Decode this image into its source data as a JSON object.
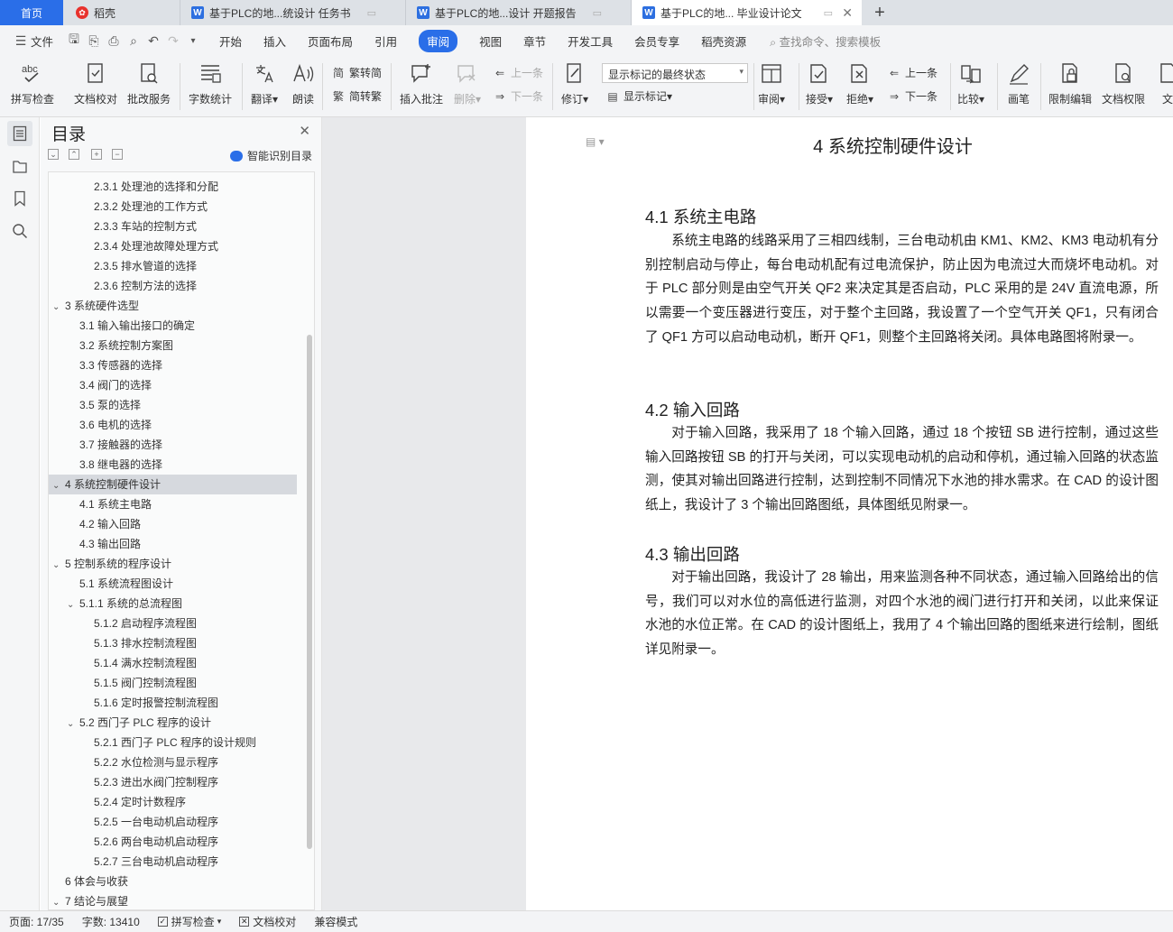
{
  "tabs": {
    "home": "首页",
    "daoke": "稻壳",
    "doc1": "基于PLC的地...统设计 任务书",
    "doc2": "基于PLC的地...设计 开题报告",
    "doc3": "基于PLC的地... 毕业设计论文"
  },
  "menu": {
    "file": "文件",
    "items": [
      "开始",
      "插入",
      "页面布局",
      "引用",
      "审阅",
      "视图",
      "章节",
      "开发工具",
      "会员专享",
      "稻壳资源"
    ],
    "active": "审阅",
    "search": "查找命令、搜索模板"
  },
  "ribbon": {
    "spellcheck": "拼写检查",
    "proofread": "文档校对",
    "batch": "批改服务",
    "wordcount": "字数统计",
    "translate": "翻译",
    "read": "朗读",
    "trad": "繁转简",
    "simp": "简转繁",
    "insert_comment": "插入批注",
    "delete": "删除",
    "prev_comment": "上一条",
    "next_comment": "下一条",
    "revise": "修订",
    "markup_state": "显示标记的最终状态",
    "show_markup": "显示标记",
    "review": "审阅",
    "accept": "接受",
    "reject": "拒绝",
    "prev_change": "上一条",
    "next_change": "下一条",
    "compare": "比较",
    "pen": "画笔",
    "restrict": "限制编辑",
    "permission": "文档权限",
    "cut_label": "文"
  },
  "nav": {
    "title": "目录",
    "smart": "智能识别目录",
    "items": [
      {
        "text": "2.3.1  处理池的选择和分配",
        "level": 3,
        "arrow": ""
      },
      {
        "text": "2.3.2  处理池的工作方式",
        "level": 3,
        "arrow": ""
      },
      {
        "text": "2.3.3  车站的控制方式",
        "level": 3,
        "arrow": ""
      },
      {
        "text": "2.3.4  处理池故障处理方式",
        "level": 3,
        "arrow": ""
      },
      {
        "text": "2.3.5  排水管道的选择",
        "level": 3,
        "arrow": ""
      },
      {
        "text": "2.3.6  控制方法的选择",
        "level": 3,
        "arrow": ""
      },
      {
        "text": "3  系统硬件选型",
        "level": 1,
        "arrow": "v"
      },
      {
        "text": "3.1  输入输出接口的确定",
        "level": 2,
        "arrow": ""
      },
      {
        "text": "3.2  系统控制方案图",
        "level": 2,
        "arrow": ""
      },
      {
        "text": "3.3  传感器的选择",
        "level": 2,
        "arrow": ""
      },
      {
        "text": "3.4  阀门的选择",
        "level": 2,
        "arrow": ""
      },
      {
        "text": "3.5  泵的选择",
        "level": 2,
        "arrow": ""
      },
      {
        "text": "3.6  电机的选择",
        "level": 2,
        "arrow": ""
      },
      {
        "text": "3.7  接触器的选择",
        "level": 2,
        "arrow": ""
      },
      {
        "text": "3.8  继电器的选择",
        "level": 2,
        "arrow": ""
      },
      {
        "text": "4  系统控制硬件设计",
        "level": 1,
        "arrow": "v",
        "selected": true
      },
      {
        "text": "4.1  系统主电路",
        "level": 2,
        "arrow": ""
      },
      {
        "text": "4.2  输入回路",
        "level": 2,
        "arrow": ""
      },
      {
        "text": "4.3  输出回路",
        "level": 2,
        "arrow": ""
      },
      {
        "text": "5  控制系统的程序设计",
        "level": 1,
        "arrow": "v"
      },
      {
        "text": "5.1  系统流程图设计",
        "level": 2,
        "arrow": ""
      },
      {
        "text": "5.1.1 系统的总流程图",
        "level": 2,
        "arrow": "v"
      },
      {
        "text": "5.1.2  启动程序流程图",
        "level": 3,
        "arrow": ""
      },
      {
        "text": "5.1.3  排水控制流程图",
        "level": 3,
        "arrow": ""
      },
      {
        "text": "5.1.4  满水控制流程图",
        "level": 3,
        "arrow": ""
      },
      {
        "text": "5.1.5  阀门控制流程图",
        "level": 3,
        "arrow": ""
      },
      {
        "text": "5.1.6  定时报警控制流程图",
        "level": 3,
        "arrow": ""
      },
      {
        "text": "5.2  西门子 PLC 程序的设计",
        "level": 2,
        "arrow": "v"
      },
      {
        "text": "5.2.1  西门子 PLC 程序的设计规则",
        "level": 3,
        "arrow": ""
      },
      {
        "text": "5.2.2  水位检测与显示程序",
        "level": 3,
        "arrow": ""
      },
      {
        "text": "5.2.3  进出水阀门控制程序",
        "level": 3,
        "arrow": ""
      },
      {
        "text": "5.2.4  定时计数程序",
        "level": 3,
        "arrow": ""
      },
      {
        "text": "5.2.5  一台电动机启动程序",
        "level": 3,
        "arrow": ""
      },
      {
        "text": "5.2.6  两台电动机启动程序",
        "level": 3,
        "arrow": ""
      },
      {
        "text": "5.2.7  三台电动机启动程序",
        "level": 3,
        "arrow": ""
      },
      {
        "text": "6  体会与收获",
        "level": 1,
        "arrow": ""
      },
      {
        "text": "7  结论与展望",
        "level": 1,
        "arrow": "v"
      }
    ]
  },
  "document": {
    "chapter": "4  系统控制硬件设计",
    "sections": [
      {
        "title": "4.1  系统主电路",
        "body": "系统主电路的线路采用了三相四线制，三台电动机由 KM1、KM2、KM3 电动机有分别控制启动与停止，每台电动机配有过电流保护，防止因为电流过大而烧坏电动机。对于 PLC 部分则是由空气开关 QF2 来决定其是否启动，PLC 采用的是 24V 直流电源，所以需要一个变压器进行变压，对于整个主回路，我设置了一个空气开关 QF1，只有闭合了 QF1 方可以启动电动机，断开 QF1，则整个主回路将关闭。具体电路图将附录一。"
      },
      {
        "title": "4.2  输入回路",
        "body": "对于输入回路，我采用了 18 个输入回路，通过 18 个按钮 SB 进行控制，通过这些输入回路按钮 SB 的打开与关闭，可以实现电动机的启动和停机，通过输入回路的状态监测，使其对输出回路进行控制，达到控制不同情况下水池的排水需求。在 CAD 的设计图纸上，我设计了 3 个输出回路图纸，具体图纸见附录一。"
      },
      {
        "title": "4.3  输出回路",
        "body": "对于输出回路，我设计了 28 输出，用来监测各种不同状态，通过输入回路给出的信号，我们可以对水位的高低进行监测，对四个水池的阀门进行打开和关闭，以此来保证水池的水位正常。在 CAD 的设计图纸上，我用了 4 个输出回路的图纸来进行绘制，图纸详见附录一。"
      }
    ]
  },
  "status": {
    "page": "页面: 17/35",
    "words": "字数: 13410",
    "spell": "拼写检查",
    "proof": "文档校对",
    "compat": "兼容模式"
  }
}
